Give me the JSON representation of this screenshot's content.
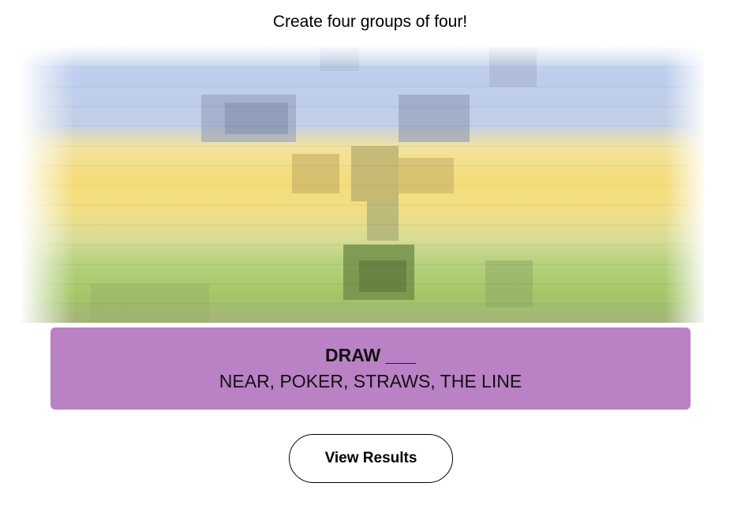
{
  "header": {
    "instructions": "Create four groups of four!"
  },
  "revealed_image": {
    "description_icon": "pixelated-image-icon"
  },
  "solved_group": {
    "title": "DRAW ___",
    "members": "NEAR, POKER, STRAWS, THE LINE",
    "color": "#ba81c5"
  },
  "actions": {
    "view_results_label": "View Results"
  }
}
